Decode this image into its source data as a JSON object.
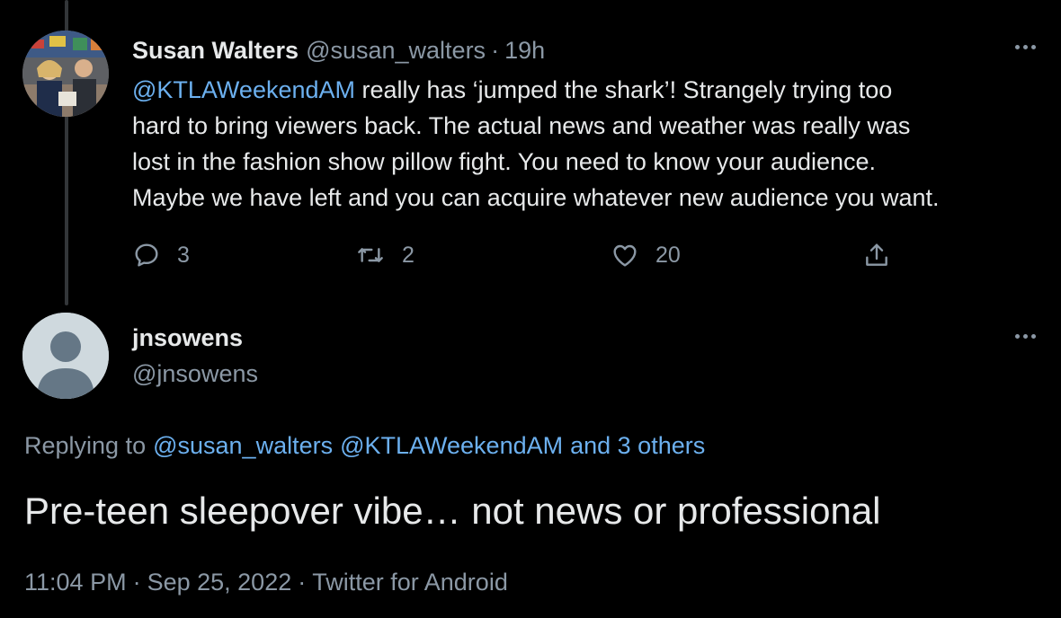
{
  "parent_tweet": {
    "author_name": "Susan Walters",
    "author_handle": "@susan_walters",
    "separator": "·",
    "time": "19h",
    "text_lines": [
      {
        "mention": "@KTLAWeekendAM",
        "text": " really has ‘jumped the shark’!  Strangely trying too"
      },
      {
        "text": "hard to bring viewers back. The actual news and weather was really was"
      },
      {
        "text": "lost in the fashion show pillow fight. You need to know your audience."
      },
      {
        "text": "Maybe we have left and you can acquire whatever new audience you want."
      }
    ],
    "reply_count": "3",
    "retweet_count": "2",
    "like_count": "20"
  },
  "main_tweet": {
    "author_name": "jnsowens",
    "author_handle": "@jnsowens",
    "replying_prefix": "Replying to",
    "replying_mention_1": "@susan_walters",
    "replying_mention_2": "@KTLAWeekendAM",
    "replying_others": "and 3 others",
    "text": "Pre-teen sleepover vibe… not news or professional",
    "time": "11:04 PM",
    "separator": "·",
    "date": "Sep 25, 2022",
    "source": "Twitter for Android"
  },
  "icons": {
    "reply": "reply-icon",
    "retweet": "retweet-icon",
    "like": "heart-icon",
    "share": "share-icon",
    "more": "more-icon"
  },
  "colors": {
    "background": "#000000",
    "text": "#e7e9ea",
    "secondary": "#8b98a5",
    "link": "#6cb0ef"
  }
}
